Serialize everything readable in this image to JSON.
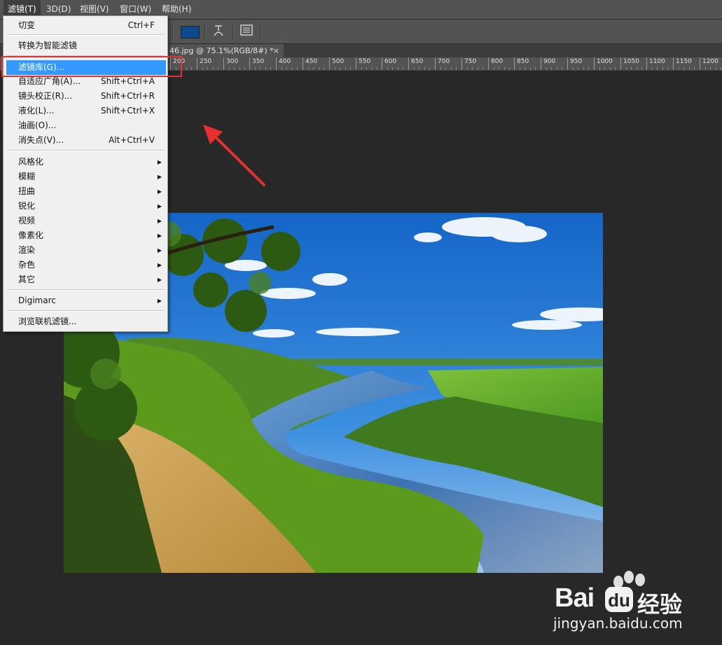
{
  "menubar": {
    "items": [
      {
        "label": "滤镜(T)",
        "active": true
      },
      {
        "label": "3D(D)"
      },
      {
        "label": "视图(V)"
      },
      {
        "label": "窗口(W)"
      },
      {
        "label": "帮助(H)"
      }
    ]
  },
  "document_tab": {
    "title": "46.jpg @ 75.1%(RGB/8#) *",
    "close": "×"
  },
  "options_bar": {
    "color_swatch": "#0b4a8c",
    "icons": [
      "warp-text-icon",
      "panel-icon"
    ]
  },
  "ruler": {
    "labels": [
      "200",
      "250",
      "300",
      "350",
      "400",
      "450",
      "500",
      "550",
      "600",
      "650",
      "700",
      "750",
      "800",
      "850",
      "900",
      "950",
      "1000",
      "1050",
      "1100",
      "1150",
      "1200"
    ]
  },
  "filter_menu": {
    "items": [
      {
        "label": "切变",
        "shortcut": "Ctrl+F"
      },
      {
        "label": "转换为智能滤镜"
      },
      {
        "label": "滤镜库(G)...",
        "highlighted": true
      },
      {
        "label": "自适应广角(A)...",
        "shortcut": "Shift+Ctrl+A"
      },
      {
        "label": "镜头校正(R)...",
        "shortcut": "Shift+Ctrl+R"
      },
      {
        "label": "液化(L)...",
        "shortcut": "Shift+Ctrl+X"
      },
      {
        "label": "油画(O)..."
      },
      {
        "label": "消失点(V)...",
        "shortcut": "Alt+Ctrl+V"
      },
      {
        "label": "风格化",
        "submenu": true
      },
      {
        "label": "模糊",
        "submenu": true
      },
      {
        "label": "扭曲",
        "submenu": true
      },
      {
        "label": "锐化",
        "submenu": true
      },
      {
        "label": "视频",
        "submenu": true
      },
      {
        "label": "像素化",
        "submenu": true
      },
      {
        "label": "渲染",
        "submenu": true
      },
      {
        "label": "杂色",
        "submenu": true
      },
      {
        "label": "其它",
        "submenu": true
      },
      {
        "label": "Digimarc",
        "submenu": true
      },
      {
        "label": "浏览联机滤镜..."
      }
    ]
  },
  "watermark": {
    "brand": "Bai",
    "brand2": "经验",
    "url": "jingyan.baidu.com"
  },
  "colors": {
    "highlight": "#3399ff",
    "annotation": "#e53030"
  }
}
